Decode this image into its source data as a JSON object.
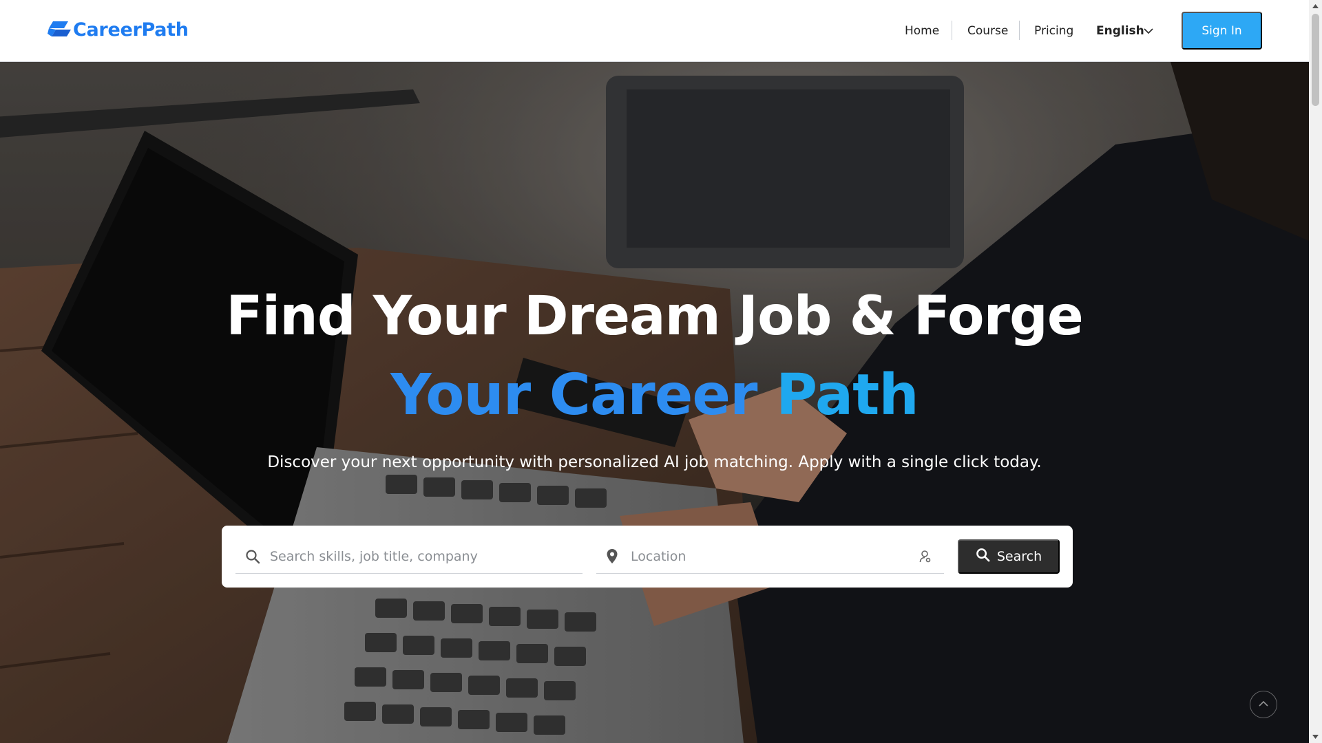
{
  "brand": {
    "name": "CareerPath",
    "color": "#1f7cf0"
  },
  "nav": {
    "items": [
      {
        "label": "Home"
      },
      {
        "label": "Course"
      },
      {
        "label": "Pricing"
      }
    ],
    "language": {
      "selected": "English"
    },
    "signin_label": "Sign In"
  },
  "hero": {
    "headline_line1": "Find Your Dream Job & Forge",
    "headline_line2_a": "Your Career",
    "headline_line2_b": "Path",
    "subtitle": "Discover your next opportunity with personalized AI job matching. Apply with a single click today."
  },
  "search": {
    "keyword_placeholder": "Search skills, job title, company",
    "keyword_value": "",
    "location_placeholder": "Location",
    "location_value": "",
    "button_label": "Search"
  },
  "icons": {
    "logo": "logo-mark-icon",
    "language": "chevron-down-icon",
    "keyword": "search-icon",
    "location": "map-pin-icon",
    "nearby": "user-location-icon",
    "search_button": "search-icon",
    "back_to_top": "chevron-up-icon"
  },
  "colors": {
    "accent": "#2da8f5",
    "headline_gradient_start": "#2d8cf0",
    "headline_gradient_end": "#1fa8ef",
    "search_button": "#2d2d2d"
  }
}
